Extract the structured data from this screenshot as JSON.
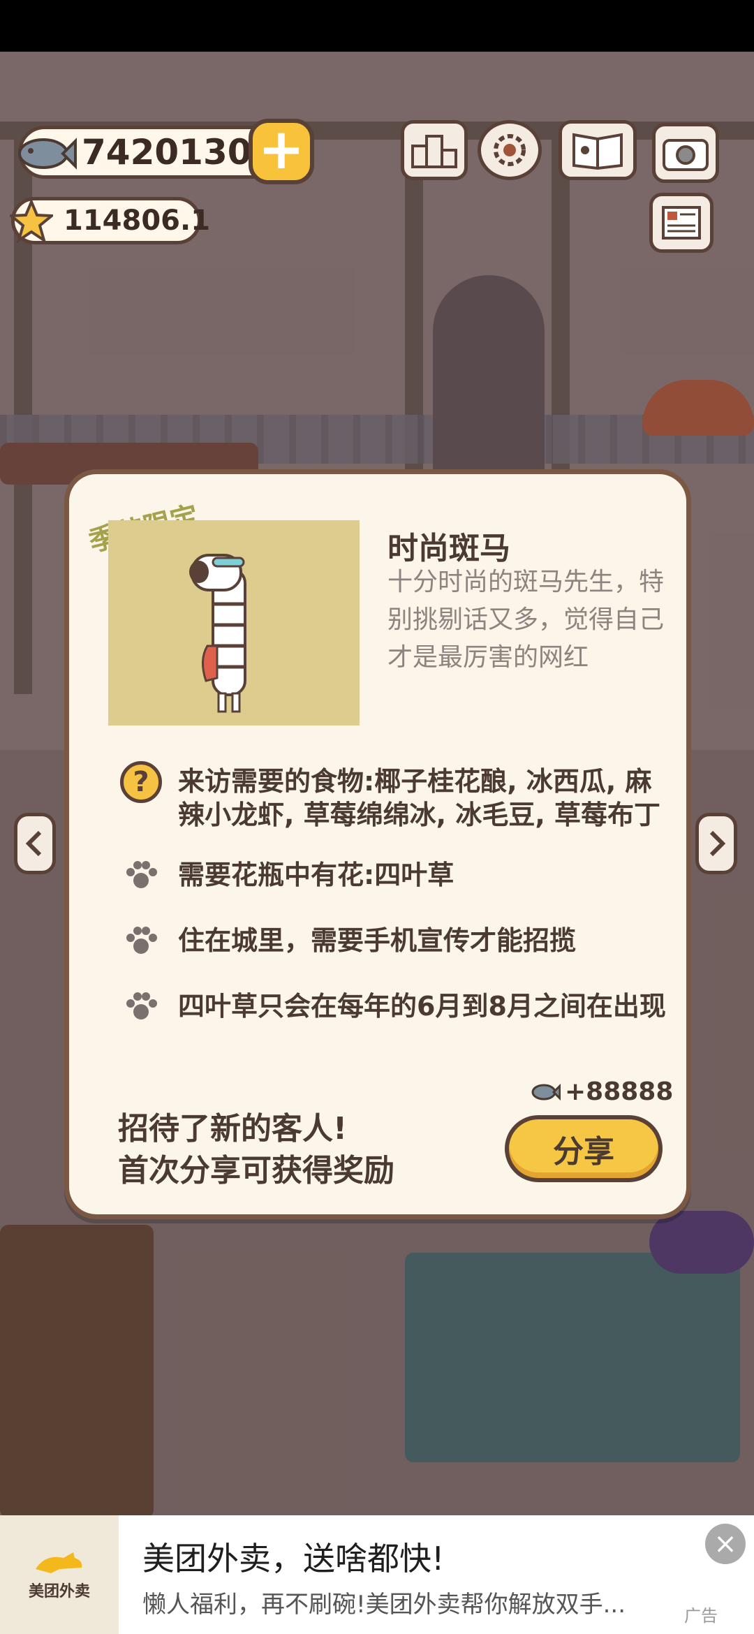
{
  "hud": {
    "fish_count": "7420130",
    "star_count": "114806.1",
    "icons": [
      "fish-icon",
      "plus-icon",
      "star-icon",
      "ranking-icon",
      "gear-icon",
      "book-icon",
      "camera-icon",
      "newspaper-icon"
    ]
  },
  "dialog": {
    "seasonal_tag": "季节限定",
    "name": "时尚斑马",
    "description": "十分时尚的斑马先生，特别挑剔话又多，觉得自己才是最厉害的网红",
    "requirements": [
      {
        "icon": "question-icon",
        "text": "来访需要的食物:椰子桂花酿, 冰西瓜, 麻辣小龙虾, 草莓绵绵冰, 冰毛豆, 草莓布丁"
      },
      {
        "icon": "paw-icon",
        "text": "需要花瓶中有花:四叶草"
      },
      {
        "icon": "paw-icon",
        "text": "住在城里，需要手机宣传才能招揽"
      },
      {
        "icon": "paw-icon",
        "text": "四叶草只会在每年的6月到8月之间在出现"
      }
    ],
    "reward": "+88888",
    "footer_line1": "招待了新的客人!",
    "footer_line2": "首次分享可获得奖励",
    "share_label": "分享"
  },
  "ad": {
    "brand": "美团外卖",
    "title": "美团外卖，送啥都快!",
    "subtitle": "懒人福利，再不刷碗!美团外卖帮你解放双手...",
    "tag": "广告"
  },
  "colors": {
    "accent_yellow": "#f6c744",
    "outline_brown": "#5a4137",
    "panel": "#fcf5ea"
  }
}
